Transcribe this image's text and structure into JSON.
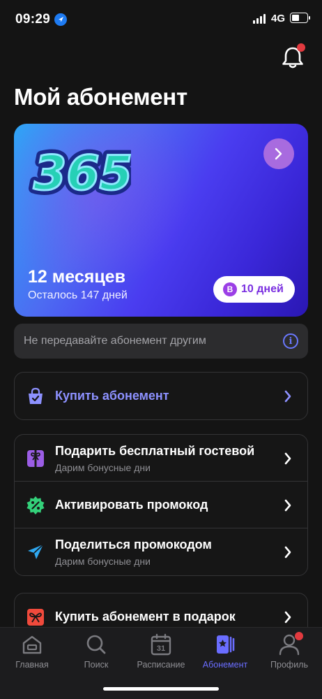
{
  "status_bar": {
    "time": "09:29",
    "network": "4G"
  },
  "page": {
    "title": "Мой абонемент"
  },
  "subscription_card": {
    "logo_text": "365",
    "duration": "12 месяцев",
    "remaining": "Осталось 147 дней",
    "bonus_badge": "B",
    "bonus_days": "10 дней"
  },
  "notice": {
    "text": "Не передавайте абонемент другим"
  },
  "buy_group": {
    "items": [
      {
        "label": "Купить абонемент",
        "icon": "shopping-bag-icon",
        "color": "#8d91ff"
      }
    ]
  },
  "actions_group": {
    "items": [
      {
        "label": "Подарить бесплатный гостевой",
        "sub": "Дарим бонусные дни",
        "icon": "gift-icon"
      },
      {
        "label": "Активировать промокод",
        "icon": "percent-badge-icon"
      },
      {
        "label": "Поделиться промокодом",
        "sub": "Дарим бонусные дни",
        "icon": "send-icon"
      }
    ]
  },
  "gift_group": {
    "items": [
      {
        "label": "Купить абонемент в подарок",
        "icon": "bow-icon"
      }
    ]
  },
  "tabbar": {
    "tabs": [
      {
        "label": "Главная",
        "icon": "home-icon"
      },
      {
        "label": "Поиск",
        "icon": "search-icon"
      },
      {
        "label": "Расписание",
        "icon": "calendar-icon",
        "day": "31"
      },
      {
        "label": "Абонемент",
        "icon": "membership-card-icon",
        "active": true
      },
      {
        "label": "Профиль",
        "icon": "profile-icon"
      }
    ]
  },
  "colors": {
    "accent": "#6a6dff",
    "background": "#141414",
    "badge_red": "#e23a3f"
  }
}
